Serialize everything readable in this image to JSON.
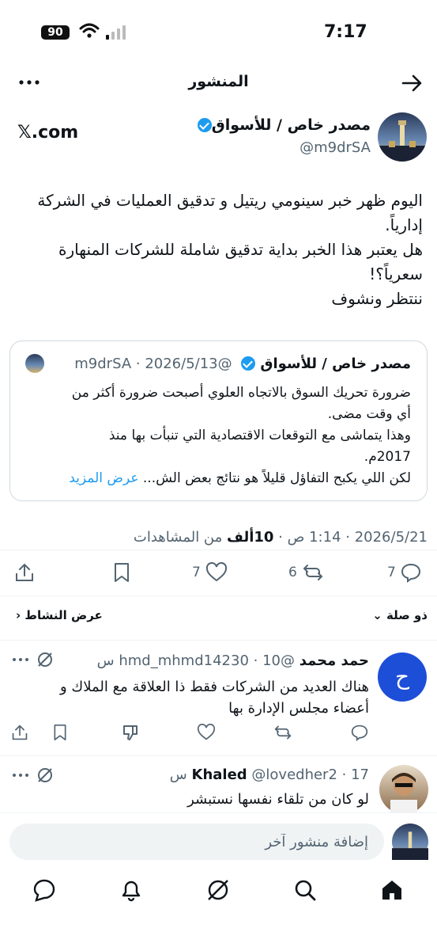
{
  "status": {
    "time": "7:17",
    "battery": "90"
  },
  "header": {
    "title": "المنشور"
  },
  "post": {
    "author_name": "مصدر خاص / للأسواق",
    "handle": "@m9drSA",
    "link_host": "𝕏.com",
    "lines": [
      "اليوم ظهر خبر سينومي ريتيل و تدقيق العمليات في الشركة",
      "إدارياً.",
      "هل يعتبر هذا الخبر بداية تدقيق شاملة للشركات المنهارة",
      "سعرياً؟!",
      "ننتظر ونشوف"
    ],
    "date": "2026/5/21",
    "time": "1:14 ص",
    "views_count": "10ألف",
    "views_label": "من المشاهدات",
    "replies": "7",
    "reposts": "6",
    "likes": "7"
  },
  "quote": {
    "author_name": "مصدر خاص / للأسواق",
    "handle": "@m9drSA",
    "date": "2026/5/13",
    "lines": [
      "ضرورة تحريك السوق بالاتجاه العلوي أصبحت ضرورة أكثر من",
      "أي وقت مضى.",
      "وهذا يتماشى مع التوقعات الاقتصادية التي تنبأت بها منذ",
      "2017م.",
      "لكن اللي يكبح التفاؤل قليلاً هو نتائج بعض الش..."
    ],
    "show_more": "عرض المزيد"
  },
  "sort": {
    "relevance": "ذو صلة",
    "activity": "عرض النشاط"
  },
  "replies": [
    {
      "name": "حمد محمد",
      "handle": "@hmd_mhmd14230",
      "time": "10 س",
      "avatar_letter": "ح",
      "avatar_color": "#1d4ed8",
      "lines": [
        "هناك العديد من الشركات فقط ذا العلاقة مع الملاك و",
        "أعضاء مجلس الإدارة بها"
      ]
    },
    {
      "name": "Khaled",
      "handle": "@lovedher2",
      "time": "17 س",
      "lines": [
        "لو كان من تلقاء نفسها نستبشر"
      ]
    }
  ],
  "compose": {
    "placeholder": "إضافة منشور آخر"
  },
  "colors": {
    "accent": "#1d9bf0",
    "text": "#0f1419",
    "muted": "#536471"
  }
}
